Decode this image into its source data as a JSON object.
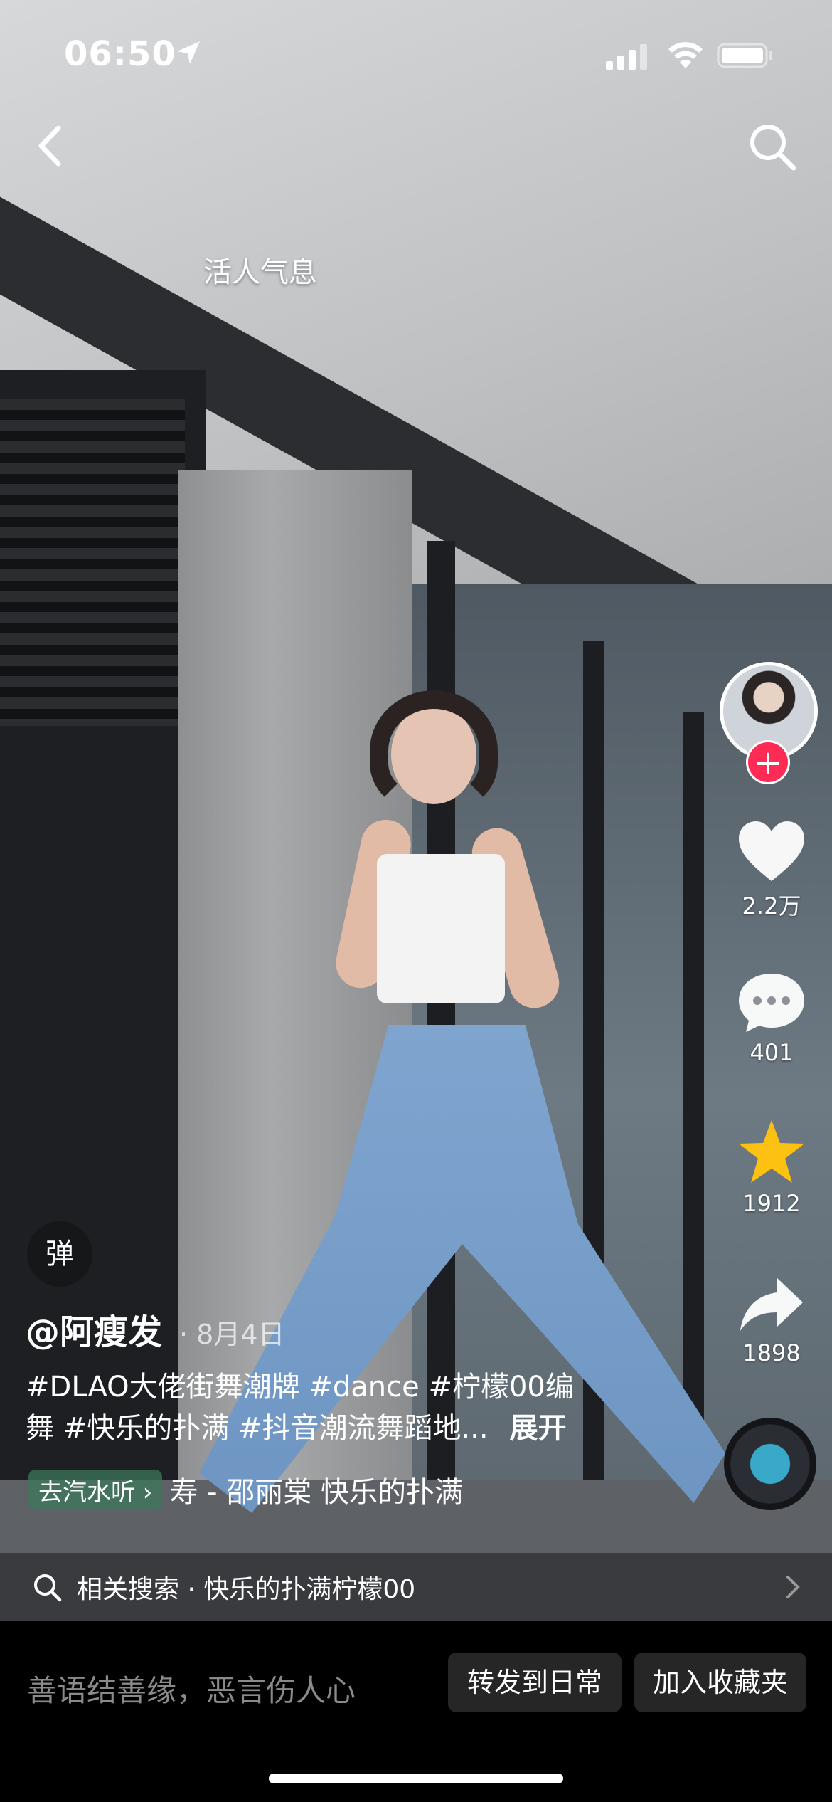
{
  "status_bar": {
    "time": "06:50"
  },
  "top": {
    "caption": "活人气息"
  },
  "author": {
    "handle": "@阿瘦发",
    "date": "· 8月4日"
  },
  "description": {
    "line1": "#DLAO大佬街舞潮牌 #dance #柠檬00编",
    "line2": "舞 #快乐的扑满 #抖音潮流舞蹈地...",
    "expand": "展开"
  },
  "danmu_label": "弹",
  "music": {
    "listen_label": "去汽水听 ›",
    "track_text": "寿 - 邵丽棠    快乐的扑满"
  },
  "rail": {
    "likes": "2.2万",
    "comments": "401",
    "favorites": "1912",
    "shares": "1898",
    "follow_symbol": "+"
  },
  "related": {
    "text": "相关搜索 · 快乐的扑满柠檬00"
  },
  "bottom_bar": {
    "comment_placeholder": "善语结善缘，恶言伤人心",
    "forward_label": "转发到日常",
    "collect_label": "加入收藏夹"
  },
  "colors": {
    "accent": "#fe2c55",
    "star": "#fcc111"
  },
  "icons": [
    "location-arrow-icon",
    "signal-icon",
    "wifi-icon",
    "battery-icon",
    "back-chevron-icon",
    "search-icon",
    "heart-icon",
    "comment-icon",
    "star-icon",
    "share-icon",
    "music-disc-icon",
    "chevron-right-icon"
  ]
}
